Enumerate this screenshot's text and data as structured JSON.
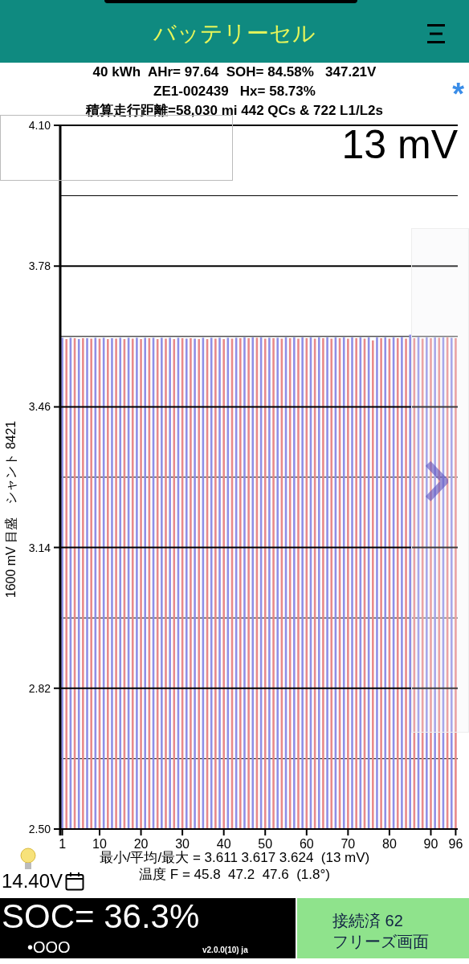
{
  "header": {
    "title": "バッテリーセル"
  },
  "summary": {
    "lines": [
      "40 kWh  AHr= 97.64  SOH= 84.58%   347.21V",
      "ZE1-002439   Hx= 58.73%",
      "積算走行距離=58,030 mi 442 QCs & 722 L1/L2s"
    ],
    "marker": "*"
  },
  "spread": "13 mV",
  "chart": {
    "chart_data": {
      "type": "bar",
      "ylabel": "1600 mV 目盛　シャント 8421",
      "x": [
        1,
        2,
        3,
        4,
        5,
        6,
        7,
        8,
        9,
        10,
        11,
        12,
        13,
        14,
        15,
        16,
        17,
        18,
        19,
        20,
        21,
        22,
        23,
        24,
        25,
        26,
        27,
        28,
        29,
        30,
        31,
        32,
        33,
        34,
        35,
        36,
        37,
        38,
        39,
        40,
        41,
        42,
        43,
        44,
        45,
        46,
        47,
        48,
        49,
        50,
        51,
        52,
        53,
        54,
        55,
        56,
        57,
        58,
        59,
        60,
        61,
        62,
        63,
        64,
        65,
        66,
        67,
        68,
        69,
        70,
        71,
        72,
        73,
        74,
        75,
        76,
        77,
        78,
        79,
        80,
        81,
        82,
        83,
        84,
        85,
        86,
        87,
        88,
        89,
        90,
        91,
        92,
        93,
        94,
        95,
        96
      ],
      "grid": true,
      "xlim": [
        0.5,
        96.5
      ],
      "values": [
        3.617,
        3.614,
        3.617,
        3.616,
        3.614,
        3.616,
        3.616,
        3.615,
        3.617,
        3.615,
        3.617,
        3.614,
        3.616,
        3.615,
        3.617,
        3.614,
        3.617,
        3.615,
        3.617,
        3.614,
        3.617,
        3.616,
        3.617,
        3.614,
        3.617,
        3.615,
        3.617,
        3.614,
        3.617,
        3.616,
        3.615,
        3.616,
        3.615,
        3.614,
        3.617,
        3.614,
        3.617,
        3.615,
        3.617,
        3.614,
        3.617,
        3.615,
        3.617,
        3.616,
        3.618,
        3.616,
        3.618,
        3.617,
        3.618,
        3.615,
        3.617,
        3.616,
        3.617,
        3.615,
        3.618,
        3.616,
        3.618,
        3.615,
        3.618,
        3.616,
        3.618,
        3.615,
        3.618,
        3.616,
        3.618,
        3.615,
        3.618,
        3.616,
        3.618,
        3.615,
        3.618,
        3.616,
        3.618,
        3.615,
        3.618,
        3.611,
        3.618,
        3.616,
        3.618,
        3.615,
        3.618,
        3.616,
        3.619,
        3.615,
        3.624,
        3.616,
        3.619,
        3.615,
        3.618,
        3.616,
        3.618,
        3.617,
        3.618,
        3.618,
        3.617,
        3.616
      ],
      "ylim": [
        2.5,
        4.1
      ],
      "yticks": [
        {
          "value": 4.1,
          "label": "4.10"
        },
        {
          "value": 3.78,
          "label": "3.78"
        },
        {
          "value": 3.46,
          "label": "3.46"
        },
        {
          "value": 3.14,
          "label": "3.14"
        },
        {
          "value": 2.82,
          "label": "2.82"
        },
        {
          "value": 2.5,
          "label": "2.50"
        }
      ],
      "xticks": [
        1,
        10,
        20,
        30,
        40,
        50,
        60,
        70,
        80,
        90,
        96
      ]
    }
  },
  "stats": [
    "最小/平均/最大 = 3.611 3.617 3.624  (13 mV)",
    "温度 F = 45.8  47.2  47.6  (1.8°)"
  ],
  "aux_voltage": "14.40V",
  "soc": "SOC= 36.3%",
  "indicator": "•OOO",
  "version": "v2.0.0(10) ja",
  "status": [
    "接続済 62",
    "フリーズ画面"
  ]
}
